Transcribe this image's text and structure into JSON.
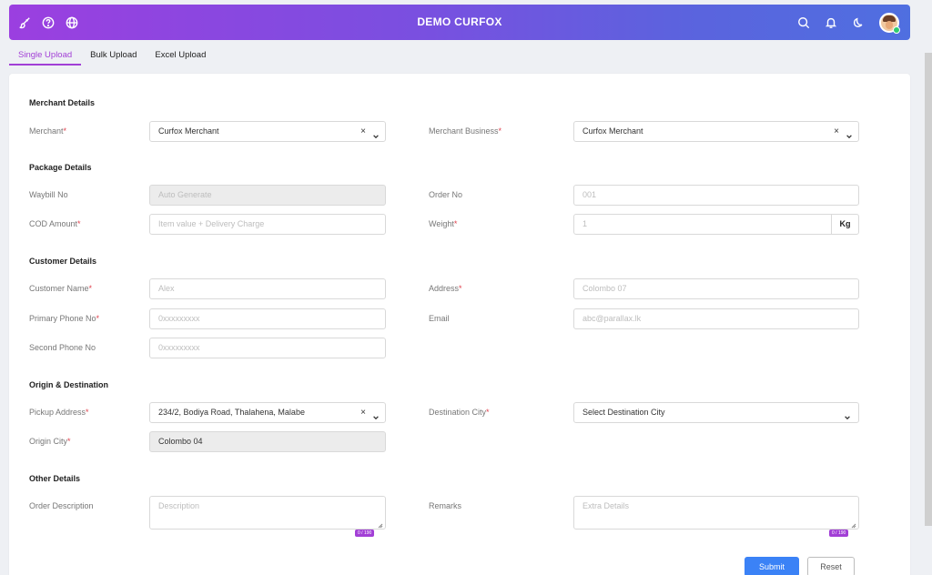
{
  "app": {
    "title": "DEMO CURFOX"
  },
  "tabs": [
    {
      "label": "Single Upload"
    },
    {
      "label": "Bulk Upload"
    },
    {
      "label": "Excel Upload"
    }
  ],
  "sections": {
    "merchant": "Merchant Details",
    "package": "Package Details",
    "customer": "Customer Details",
    "origin": "Origin & Destination",
    "other": "Other Details"
  },
  "fields": {
    "merchant": {
      "label": "Merchant",
      "value": "Curfox Merchant"
    },
    "merchant_business": {
      "label": "Merchant Business",
      "value": "Curfox Merchant"
    },
    "waybill": {
      "label": "Waybill No",
      "placeholder": "Auto Generate"
    },
    "order_no": {
      "label": "Order No",
      "placeholder": "001"
    },
    "cod_amount": {
      "label": "COD Amount",
      "placeholder": "Item value + Delivery Charge"
    },
    "weight": {
      "label": "Weight",
      "placeholder": "1",
      "unit": "Kg"
    },
    "customer_name": {
      "label": "Customer Name",
      "placeholder": "Alex"
    },
    "address": {
      "label": "Address",
      "placeholder": "Colombo 07"
    },
    "primary_phone": {
      "label": "Primary Phone No",
      "placeholder": "0xxxxxxxxx"
    },
    "email": {
      "label": "Email",
      "placeholder": "abc@parallax.lk"
    },
    "second_phone": {
      "label": "Second Phone No",
      "placeholder": "0xxxxxxxxx"
    },
    "pickup_address": {
      "label": "Pickup Address",
      "value": "234/2, Bodiya Road, Thalahena, Malabe"
    },
    "destination_city": {
      "label": "Destination City",
      "value": "Select Destination City"
    },
    "origin_city": {
      "label": "Origin City",
      "value": "Colombo 04"
    },
    "order_description": {
      "label": "Order Description",
      "placeholder": "Description",
      "counter": "0 / 190"
    },
    "remarks": {
      "label": "Remarks",
      "placeholder": "Extra Details",
      "counter": "0 / 190"
    }
  },
  "required_mark": "*",
  "clear_glyph": "×",
  "buttons": {
    "submit": "Submit",
    "reset": "Reset"
  },
  "icons": {
    "left": [
      "brush-icon",
      "help-icon",
      "globe-icon"
    ],
    "right": [
      "search-icon",
      "bell-icon",
      "moon-icon"
    ]
  },
  "colors": {
    "accent": "#a23fd6",
    "header_start": "#9b3fe0",
    "header_end": "#4f6fe0",
    "submit": "#3b82f6",
    "required": "#e0424e"
  }
}
